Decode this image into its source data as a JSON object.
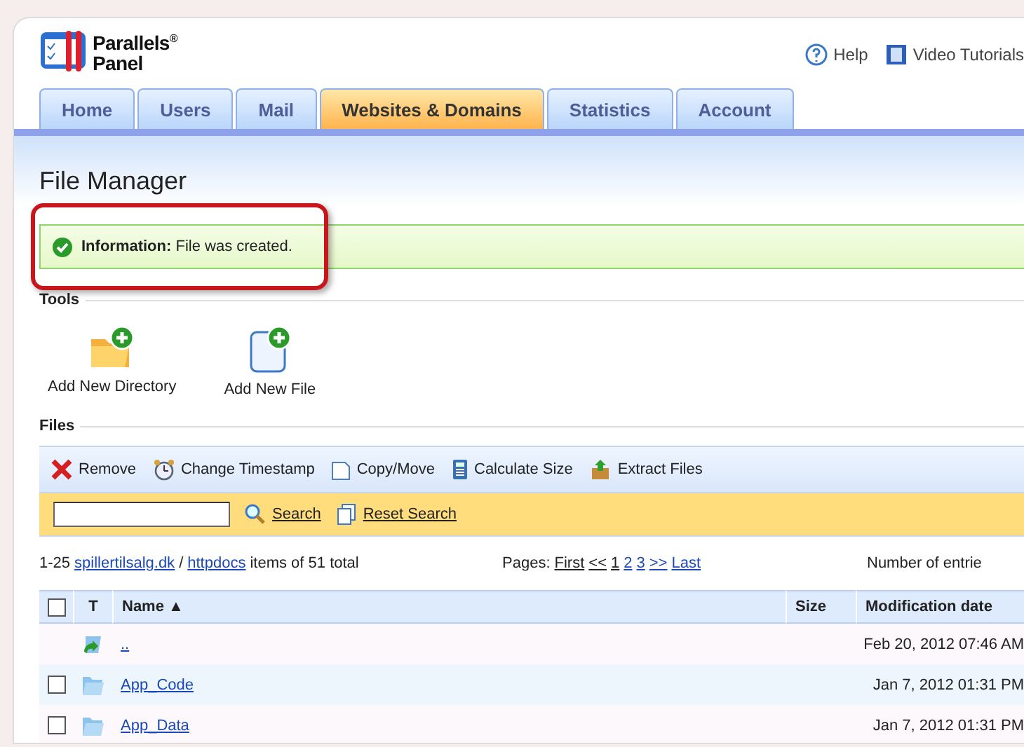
{
  "logo": {
    "line1": "Parallels",
    "reg": "®",
    "line2": "Panel"
  },
  "header_links": [
    {
      "kind": "help",
      "label": "Help"
    },
    {
      "kind": "video",
      "label": "Video Tutorials"
    }
  ],
  "tabs": [
    {
      "label": "Home",
      "selected": false
    },
    {
      "label": "Users",
      "selected": false
    },
    {
      "label": "Mail",
      "selected": false
    },
    {
      "label": "Websites & Domains",
      "selected": true
    },
    {
      "label": "Statistics",
      "selected": false
    },
    {
      "label": "Account",
      "selected": false
    }
  ],
  "page_title": "File Manager",
  "notification": {
    "label": "Information:",
    "text": "File was created.",
    "highlighted": true
  },
  "tools": {
    "title": "Tools",
    "items": [
      {
        "kind": "directory",
        "label": "Add New Directory"
      },
      {
        "kind": "file",
        "label": "Add New File"
      }
    ]
  },
  "files": {
    "title": "Files",
    "actions": [
      {
        "kind": "remove",
        "label": "Remove"
      },
      {
        "kind": "timestamp",
        "label": "Change Timestamp"
      },
      {
        "kind": "copy",
        "label": "Copy/Move"
      },
      {
        "kind": "size",
        "label": "Calculate Size"
      },
      {
        "kind": "extract",
        "label": "Extract Files"
      }
    ],
    "search": {
      "search_label": "Search",
      "reset_label": "Reset Search"
    },
    "summary": {
      "range": "1-25",
      "domain": "spillertilsalg.dk",
      "separator": "/",
      "folder": "httpdocs",
      "total": "items of 51 total"
    },
    "pages": {
      "label": "Pages:",
      "links": [
        {
          "label": "First",
          "enabled": false
        },
        {
          "label": "<<",
          "enabled": false
        },
        {
          "label": "1",
          "enabled": false
        },
        {
          "label": "2",
          "enabled": true
        },
        {
          "label": "3",
          "enabled": true
        },
        {
          "label": ">>",
          "enabled": true
        },
        {
          "label": "Last",
          "enabled": true
        }
      ]
    },
    "entries_label": "Number of entrie",
    "columns": [
      "T",
      "Name ▲",
      "Size",
      "Modification date"
    ],
    "select_all": {
      "checked": false
    },
    "rows": [
      {
        "kind": "up",
        "name": "..",
        "date": "Feb 20, 2012 07:46 AM"
      },
      {
        "kind": "folder",
        "name": "App_Code",
        "date": "Jan 7, 2012 01:31 PM",
        "checked": false
      },
      {
        "kind": "folder",
        "name": "App_Data",
        "date": "Jan 7, 2012 01:31 PM",
        "checked": false
      }
    ]
  }
}
